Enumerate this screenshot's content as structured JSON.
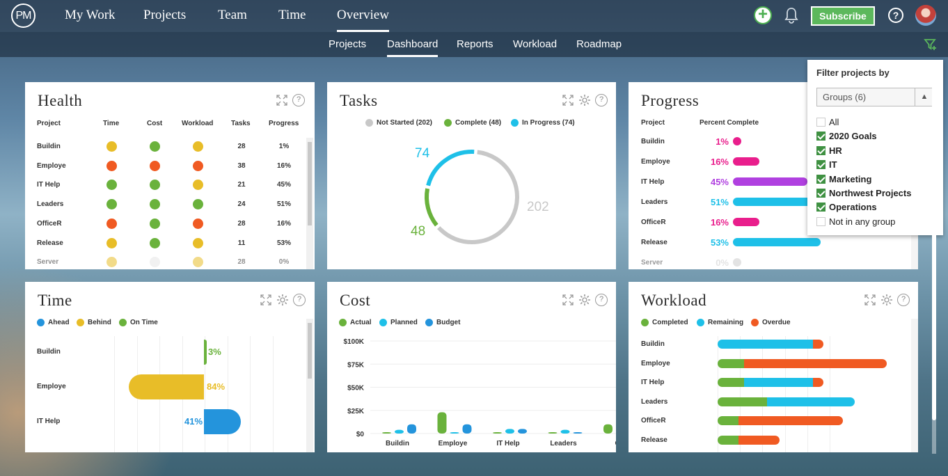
{
  "topnav": {
    "logo": "PM",
    "items": [
      "My Work",
      "Projects",
      "Team",
      "Time",
      "Overview"
    ],
    "active": "Overview",
    "subscribe": "Subscribe"
  },
  "subnav": {
    "items": [
      "Projects",
      "Dashboard",
      "Reports",
      "Workload",
      "Roadmap"
    ],
    "active": "Dashboard"
  },
  "health": {
    "title": "Health",
    "headers": [
      "Project",
      "Time",
      "Cost",
      "Workload",
      "Tasks",
      "Progress"
    ],
    "rows": [
      {
        "project": "Buildin",
        "time": "yellow",
        "cost": "green",
        "workload": "yellow",
        "tasks": "28",
        "progress": "1%"
      },
      {
        "project": "Employe",
        "time": "red",
        "cost": "red",
        "workload": "red",
        "tasks": "38",
        "progress": "16%"
      },
      {
        "project": "IT Help",
        "time": "green",
        "cost": "green",
        "workload": "yellow",
        "tasks": "21",
        "progress": "45%"
      },
      {
        "project": "Leaders",
        "time": "green",
        "cost": "green",
        "workload": "green",
        "tasks": "24",
        "progress": "51%"
      },
      {
        "project": "OfficeR",
        "time": "red",
        "cost": "green",
        "workload": "red",
        "tasks": "28",
        "progress": "16%"
      },
      {
        "project": "Release",
        "time": "yellow",
        "cost": "green",
        "workload": "yellow",
        "tasks": "11",
        "progress": "53%"
      },
      {
        "project": "Server",
        "time": "yellow",
        "cost": "grey",
        "workload": "yellow",
        "tasks": "28",
        "progress": "0%"
      }
    ]
  },
  "tasks": {
    "title": "Tasks",
    "legend": [
      "Not Started (202)",
      "Complete (48)",
      "In Progress (74)"
    ],
    "values": {
      "not_started": 202,
      "complete": 48,
      "in_progress": 74
    },
    "labels": {
      "in_progress": "74",
      "complete": "48",
      "not_started": "202"
    }
  },
  "progress": {
    "title": "Progress",
    "headers": [
      "Project",
      "Percent Complete"
    ],
    "rows": [
      {
        "project": "Buildin",
        "pct": "1%",
        "value": 1,
        "color": "#e91e8c"
      },
      {
        "project": "Employe",
        "pct": "16%",
        "value": 16,
        "color": "#e91e8c"
      },
      {
        "project": "IT Help",
        "pct": "45%",
        "value": 45,
        "color": "#b040e0"
      },
      {
        "project": "Leaders",
        "pct": "51%",
        "value": 51,
        "color": "#1ec0e8"
      },
      {
        "project": "OfficeR",
        "pct": "16%",
        "value": 16,
        "color": "#e91e8c"
      },
      {
        "project": "Release",
        "pct": "53%",
        "value": 53,
        "color": "#1ec0e8"
      },
      {
        "project": "Server",
        "pct": "0%",
        "value": 0,
        "color": "#c8c8c8"
      }
    ]
  },
  "time": {
    "title": "Time",
    "legend": [
      "Ahead",
      "Behind",
      "On Time"
    ],
    "rows": [
      {
        "project": "Buildin",
        "label": "3%",
        "value": 3,
        "status": "on_time"
      },
      {
        "project": "Employe",
        "label": "84%",
        "value": -84,
        "status": "behind"
      },
      {
        "project": "IT Help",
        "label": "41%",
        "value": 41,
        "status": "ahead"
      }
    ]
  },
  "cost": {
    "title": "Cost",
    "legend": [
      "Actual",
      "Planned",
      "Budget"
    ],
    "yticks": [
      "$100K",
      "$75K",
      "$50K",
      "$25K",
      "$0"
    ],
    "categories": [
      "Buildin",
      "Employe",
      "IT Help",
      "Leaders",
      "Of"
    ],
    "series": [
      {
        "name": "Actual",
        "values": [
          1,
          23,
          1,
          1,
          10
        ]
      },
      {
        "name": "Planned",
        "values": [
          4,
          1,
          5,
          4,
          0
        ]
      },
      {
        "name": "Budget",
        "values": [
          10,
          10,
          5,
          1,
          0
        ]
      }
    ],
    "ylim": [
      0,
      100
    ]
  },
  "workload": {
    "title": "Workload",
    "legend": [
      "Completed",
      "Remaining",
      "Overdue"
    ],
    "rows": [
      {
        "project": "Buildin",
        "completed": 0,
        "remaining": 54,
        "overdue": 6
      },
      {
        "project": "Employe",
        "completed": 15,
        "remaining": 0,
        "overdue": 81
      },
      {
        "project": "IT Help",
        "completed": 15,
        "remaining": 39,
        "overdue": 6
      },
      {
        "project": "Leaders",
        "completed": 28,
        "remaining": 50,
        "overdue": 0
      },
      {
        "project": "OfficeR",
        "completed": 12,
        "remaining": 0,
        "overdue": 59
      },
      {
        "project": "Release",
        "completed": 12,
        "remaining": 0,
        "overdue": 23
      }
    ]
  },
  "filter": {
    "title": "Filter projects by",
    "select": "Groups (6)",
    "options": [
      {
        "label": "All",
        "checked": false
      },
      {
        "label": "2020 Goals",
        "checked": true
      },
      {
        "label": "HR",
        "checked": true
      },
      {
        "label": "IT",
        "checked": true
      },
      {
        "label": "Marketing",
        "checked": true
      },
      {
        "label": "Northwest Projects",
        "checked": true
      },
      {
        "label": "Operations",
        "checked": true
      },
      {
        "label": "Not in any group",
        "checked": false
      }
    ]
  },
  "colors": {
    "green": "#6ab23c",
    "yellow": "#e8bd28",
    "red": "#f05a22",
    "grey": "#e6e6e6",
    "blue": "#2494dc",
    "cyan": "#1ec0e8",
    "notstarted": "#c8c8c8"
  }
}
